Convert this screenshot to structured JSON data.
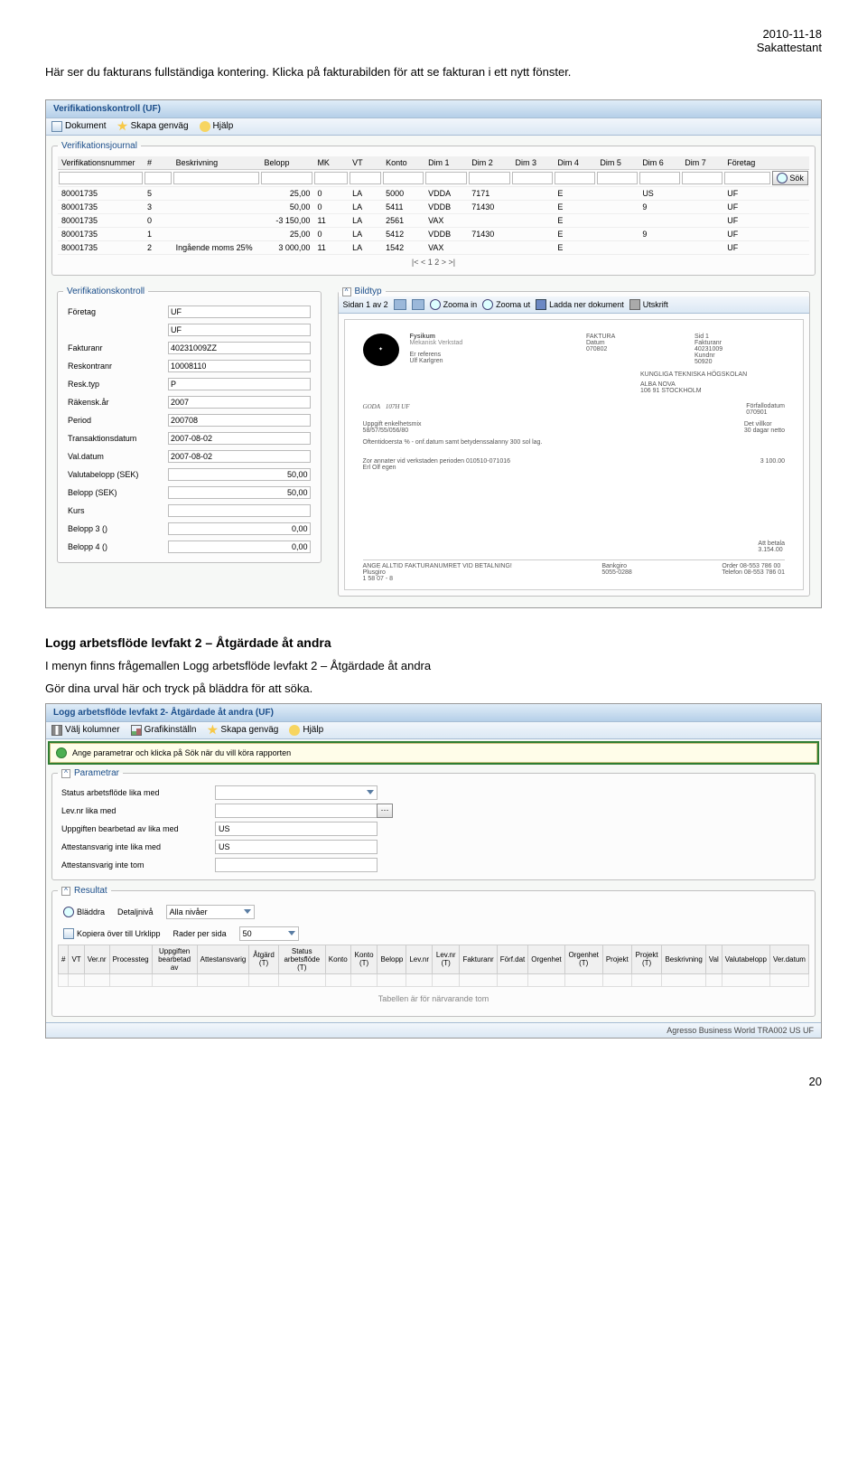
{
  "page": {
    "date": "2010-11-18",
    "role": "Sakattestant",
    "intro": "Här ser du fakturans fullständiga kontering. Klicka på fakturabilden för att se fakturan i ett nytt fönster.",
    "pageNumber": "20"
  },
  "app1": {
    "title": "Verifikationskontroll (UF)",
    "toolbar": {
      "dokument": "Dokument",
      "skapa": "Skapa genväg",
      "hjalp": "Hjälp"
    },
    "journal": {
      "legend": "Verifikationsjournal",
      "headers": [
        "Verifikationsnummer",
        "#",
        "Beskrivning",
        "Belopp",
        "MK",
        "VT",
        "Konto",
        "Dim 1",
        "Dim 2",
        "Dim 3",
        "Dim 4",
        "Dim 5",
        "Dim 6",
        "Dim 7",
        "Företag"
      ],
      "sok": "Sök",
      "rows": [
        {
          "vn": "80001735",
          "n": "5",
          "b": "",
          "bel": "25,00",
          "mk": "0",
          "vt": "LA",
          "k": "5000",
          "d1": "VDDA",
          "d2": "7171",
          "d3": "",
          "d4": "E",
          "d5": "",
          "d6": "US",
          "d7": "",
          "f": "UF"
        },
        {
          "vn": "80001735",
          "n": "3",
          "b": "",
          "bel": "50,00",
          "mk": "0",
          "vt": "LA",
          "k": "5411",
          "d1": "VDDB",
          "d2": "71430",
          "d3": "",
          "d4": "E",
          "d5": "",
          "d6": "9",
          "d7": "",
          "f": "UF"
        },
        {
          "vn": "80001735",
          "n": "0",
          "b": "",
          "bel": "-3 150,00",
          "mk": "11",
          "vt": "LA",
          "k": "2561",
          "d1": "VAX",
          "d2": "",
          "d3": "",
          "d4": "E",
          "d5": "",
          "d6": "",
          "d7": "",
          "f": "UF"
        },
        {
          "vn": "80001735",
          "n": "1",
          "b": "",
          "bel": "25,00",
          "mk": "0",
          "vt": "LA",
          "k": "5412",
          "d1": "VDDB",
          "d2": "71430",
          "d3": "",
          "d4": "E",
          "d5": "",
          "d6": "9",
          "d7": "",
          "f": "UF"
        },
        {
          "vn": "80001735",
          "n": "2",
          "b": "Ingående moms 25%",
          "bel": "3 000,00",
          "mk": "11",
          "vt": "LA",
          "k": "1542",
          "d1": "VAX",
          "d2": "",
          "d3": "",
          "d4": "E",
          "d5": "",
          "d6": "",
          "d7": "",
          "f": "UF"
        }
      ],
      "pager": "|<  <  1 2  >  >|"
    },
    "kontroll": {
      "legend": "Verifikationskontroll",
      "fields": [
        {
          "label": "Företag",
          "v1": "UF",
          "v2": "UF"
        },
        {
          "label": "Fakturanr",
          "v1": "40231009ZZ"
        },
        {
          "label": "Reskontranr",
          "v1": "10008110"
        },
        {
          "label": "Resk.typ",
          "v1": "P"
        },
        {
          "label": "Räkensk.år",
          "v1": "2007"
        },
        {
          "label": "Period",
          "v1": "200708"
        },
        {
          "label": "Transaktionsdatum",
          "v1": "2007-08-02"
        },
        {
          "label": "Val.datum",
          "v1": "2007-08-02"
        },
        {
          "label": "Valutabelopp (SEK)",
          "v1": "50,00",
          "num": true
        },
        {
          "label": "Belopp (SEK)",
          "v1": "50,00",
          "num": true
        },
        {
          "label": "Kurs",
          "v1": ""
        },
        {
          "label": "Belopp 3 ()",
          "v1": "0,00",
          "num": true
        },
        {
          "label": "Belopp 4 ()",
          "v1": "0,00",
          "num": true
        }
      ]
    },
    "bild": {
      "legend": "Bildtyp",
      "sidan": "Sidan 1 av 2",
      "zoomIn": "Zooma in",
      "zoomUt": "Zooma ut",
      "ladda": "Ladda ner dokument",
      "utskrift": "Utskrift",
      "doc": {
        "fysikum": "Fysikum",
        "goda": "GODA",
        "kth": "KUNGLIGA TEKNISKA HÖGSKOLAN",
        "totala": "Att betala"
      }
    }
  },
  "section2": {
    "heading": "Logg arbetsflöde levfakt 2 – Åtgärdade åt andra",
    "p1": "I menyn finns frågemallen Logg arbetsflöde levfakt 2 – Åtgärdade åt andra",
    "p2": "Gör dina urval här och tryck på bläddra för att söka."
  },
  "app2": {
    "title": "Logg arbetsflöde levfakt 2- Åtgärdade åt andra (UF)",
    "toolbar": {
      "valj": "Välj kolumner",
      "grafik": "Grafikinställn",
      "skapa": "Skapa genväg",
      "hjalp": "Hjälp"
    },
    "info": "Ange parametrar och klicka på Sök när du vill köra rapporten",
    "parametrar": {
      "legend": "Parametrar",
      "rows": [
        {
          "label": "Status arbetsflöde lika med",
          "value": "",
          "type": "dropdown"
        },
        {
          "label": "Lev.nr lika med",
          "value": "",
          "type": "ellipsis"
        },
        {
          "label": "Uppgiften bearbetad av lika med",
          "value": "US",
          "type": "text"
        },
        {
          "label": "Attestansvarig inte lika med",
          "value": "US",
          "type": "text"
        },
        {
          "label": "Attestansvarig inte tom",
          "value": "",
          "type": "text"
        }
      ]
    },
    "resultat": {
      "legend": "Resultat",
      "bladdra": "Bläddra",
      "detaljniva": "Detaljnivå",
      "allaNivaer": "Alla nivåer",
      "kopiera": "Kopiera över till Urklipp",
      "raderPer": "Rader per sida",
      "r50": "50",
      "headers": [
        "#",
        "VT",
        "Ver.nr",
        "Processteg",
        "Uppgiften bearbetad av",
        "Attestansvarig",
        "Åtgärd (T)",
        "Status arbetsflöde (T)",
        "Konto",
        "Konto (T)",
        "Belopp",
        "Lev.nr",
        "Lev.nr (T)",
        "Fakturanr",
        "Förf.dat",
        "Orgenhet",
        "Orgenhet (T)",
        "Projekt",
        "Projekt (T)",
        "Beskrivning",
        "Val",
        "Valutabelopp",
        "Ver.datum"
      ],
      "empty": "Tabellen är för närvarande tom"
    },
    "status": "Agresso Business World   TRA002  US  UF"
  }
}
